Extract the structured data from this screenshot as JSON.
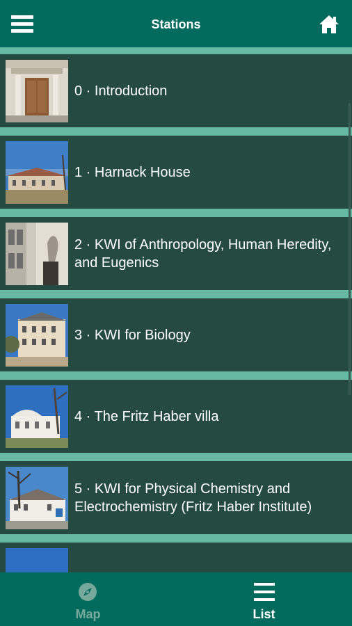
{
  "header": {
    "title": "Stations",
    "menu_icon": "hamburger-menu-icon",
    "home_icon": "home-icon"
  },
  "stations": [
    {
      "label": "0 · Introduction"
    },
    {
      "label": "1 · Harnack House"
    },
    {
      "label": "2 · KWI of Anthropology, Human Heredity, and Eugenics"
    },
    {
      "label": "3 · KWI for Biology"
    },
    {
      "label": "4 · The Fritz Haber villa"
    },
    {
      "label": "5 · KWI for Physical Chemistry and Electrochemistry (Fritz Haber Institute)"
    }
  ],
  "bottom_nav": {
    "map_label": "Map",
    "list_label": "List",
    "map_icon": "compass-icon",
    "list_icon": "list-icon",
    "active_tab": "List"
  },
  "colors": {
    "header_bg": "#036b5d",
    "list_bg": "#244a42",
    "divider": "#68b9a3",
    "active_tab_text": "#ffffff",
    "inactive_tab_text": "#76a99c"
  }
}
